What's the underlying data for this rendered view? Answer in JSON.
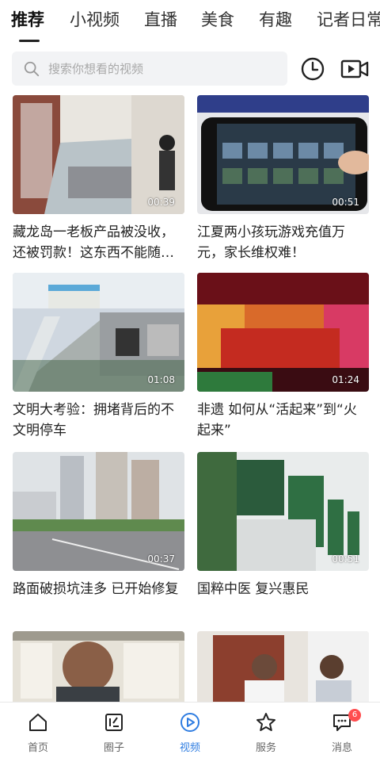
{
  "tabs": [
    "推荐",
    "小视频",
    "直播",
    "美食",
    "有趣",
    "记者日常"
  ],
  "search": {
    "placeholder": "搜索你想看的视频"
  },
  "videos": [
    {
      "title": "藏龙岛一老板产品被没收，还被罚款！这东西不能随…",
      "duration": "00:39"
    },
    {
      "title": "江夏两小孩玩游戏充值万元，家长维权难！",
      "duration": "00:51"
    },
    {
      "title": "文明大考验：拥堵背后的不文明停车",
      "duration": "01:08"
    },
    {
      "title": "非遗 如何从“活起来”到“火起来”",
      "duration": "01:24"
    },
    {
      "title": "路面破损坑洼多 已开始修复",
      "duration": "00:37"
    },
    {
      "title": "国粹中医 复兴惠民",
      "duration": "00:51"
    },
    {
      "title": "",
      "duration": ""
    },
    {
      "title": "",
      "duration": ""
    }
  ],
  "bottom_nav": [
    {
      "label": "首页",
      "icon": "home-icon"
    },
    {
      "label": "圈子",
      "icon": "circle-post-icon"
    },
    {
      "label": "视频",
      "icon": "play-circle-icon"
    },
    {
      "label": "服务",
      "icon": "star-icon"
    },
    {
      "label": "消息",
      "icon": "message-icon",
      "badge": "6"
    }
  ],
  "colors": {
    "accent": "#2f7de1",
    "badge": "#ff4d4f",
    "search_bg": "#f2f3f5"
  }
}
